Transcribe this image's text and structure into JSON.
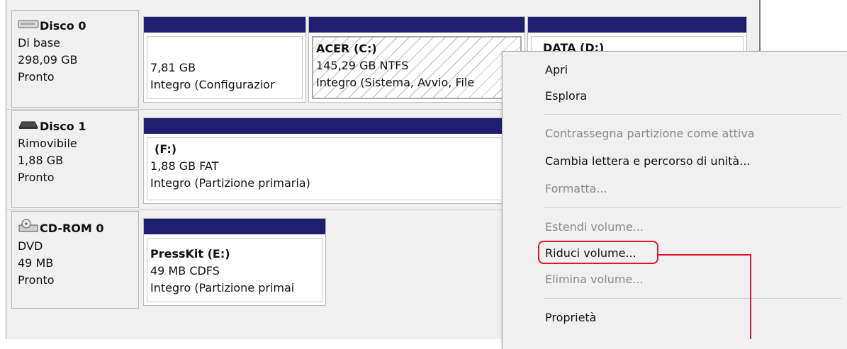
{
  "disks": [
    {
      "name": "Disco 0",
      "type": "Di base",
      "size": "298,09 GB",
      "status": "Pronto",
      "icon": "hard-disk-icon"
    },
    {
      "name": "Disco 1",
      "type": "Rimovibile",
      "size": "1,88 GB",
      "status": "Pronto",
      "icon": "removable-disk-icon"
    },
    {
      "name": "CD-ROM 0",
      "type": "DVD",
      "size": "49 MB",
      "status": "Pronto",
      "icon": "cdrom-icon"
    }
  ],
  "partitions": {
    "d0_p1": {
      "title": "",
      "line1": "7,81 GB",
      "line2": "Integro (Configurazior"
    },
    "d0_p2": {
      "title": "ACER  (C:)",
      "line1": "145,29 GB NTFS",
      "line2": "Integro (Sistema, Avvio, File"
    },
    "d0_p3": {
      "title": "DATA  (D:)"
    },
    "d1_p1": {
      "title": "(F:)",
      "line1": "1,88 GB FAT",
      "line2": "Integro (Partizione primaria)"
    },
    "cd_p1": {
      "title": "PressKit  (E:)",
      "line1": "49 MB CDFS",
      "line2": "Integro (Partizione primai"
    }
  },
  "menu": {
    "open": "Apri",
    "explore": "Esplora",
    "mark_active": "Contrassegna partizione come attiva",
    "change_letter": "Cambia lettera e percorso di unità...",
    "format": "Formatta...",
    "extend": "Estendi volume...",
    "shrink": "Riduci volume...",
    "delete": "Elimina volume...",
    "properties": "Proprietà"
  },
  "colors": {
    "partition_bar": "#1e1e70",
    "highlight": "#e0182a",
    "disabled_text": "#8a8a8a"
  }
}
